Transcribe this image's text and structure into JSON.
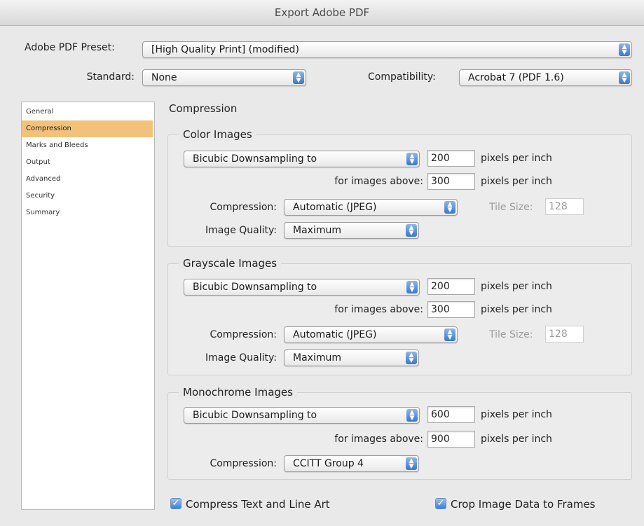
{
  "window": {
    "title": "Export Adobe PDF"
  },
  "top": {
    "preset_label": "Adobe PDF Preset:",
    "preset_value": "[High Quality Print] (modified)",
    "standard_label": "Standard:",
    "standard_value": "None",
    "compat_label": "Compatibility:",
    "compat_value": "Acrobat 7 (PDF 1.6)"
  },
  "sidebar": {
    "items": [
      {
        "label": "General"
      },
      {
        "label": "Compression"
      },
      {
        "label": "Marks and Bleeds"
      },
      {
        "label": "Output"
      },
      {
        "label": "Advanced"
      },
      {
        "label": "Security"
      },
      {
        "label": "Summary"
      }
    ],
    "selected": "Compression"
  },
  "main": {
    "section_title": "Compression",
    "color": {
      "title": "Color Images",
      "sampling": "Bicubic Downsampling to",
      "ppi": "200",
      "ppi_unit": "pixels per inch",
      "above_label": "for images above:",
      "above": "300",
      "above_unit": "pixels per inch",
      "compression_label": "Compression:",
      "compression": "Automatic (JPEG)",
      "tile_label": "Tile Size:",
      "tile": "128",
      "quality_label": "Image Quality:",
      "quality": "Maximum"
    },
    "gray": {
      "title": "Grayscale Images",
      "sampling": "Bicubic Downsampling to",
      "ppi": "200",
      "ppi_unit": "pixels per inch",
      "above_label": "for images above:",
      "above": "300",
      "above_unit": "pixels per inch",
      "compression_label": "Compression:",
      "compression": "Automatic (JPEG)",
      "tile_label": "Tile Size:",
      "tile": "128",
      "quality_label": "Image Quality:",
      "quality": "Maximum"
    },
    "mono": {
      "title": "Monochrome Images",
      "sampling": "Bicubic Downsampling to",
      "ppi": "600",
      "ppi_unit": "pixels per inch",
      "above_label": "for images above:",
      "above": "900",
      "above_unit": "pixels per inch",
      "compression_label": "Compression:",
      "compression": "CCITT Group 4"
    },
    "compress_text_label": "Compress Text and Line Art",
    "crop_label": "Crop Image Data to Frames"
  },
  "colors": {
    "accent": "#3a78cc",
    "selection": "#f2c27a"
  },
  "icons": {
    "popup": "up-down-arrows-icon",
    "check": "checkmark-icon"
  }
}
